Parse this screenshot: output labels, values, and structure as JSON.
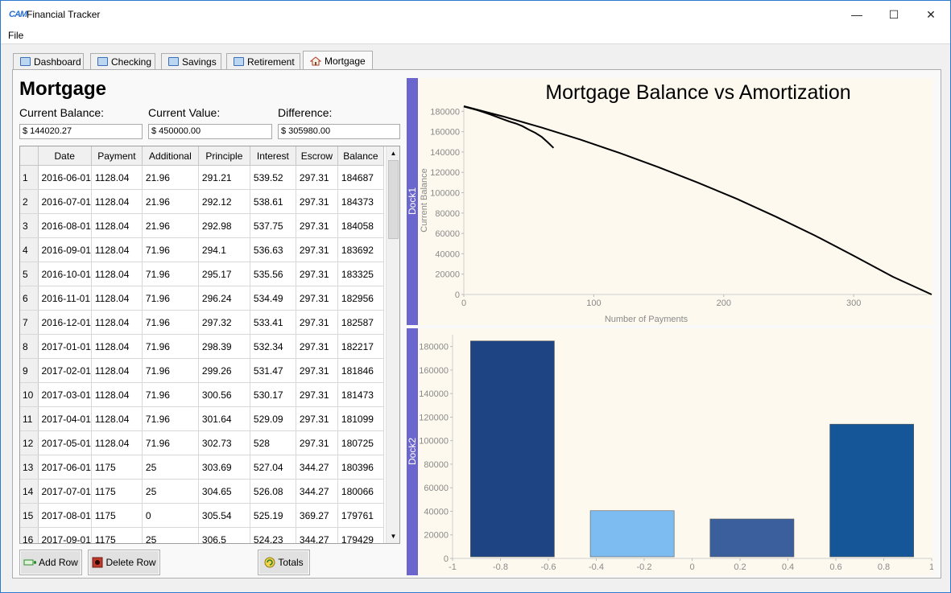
{
  "window": {
    "app_icon": "CAM",
    "title": "Financial Tracker",
    "controls": {
      "minimize": "—",
      "maximize": "☐",
      "close": "✕"
    }
  },
  "menu": {
    "file": "File"
  },
  "tabs": [
    {
      "label": "Dashboard",
      "icon": "money-icon"
    },
    {
      "label": "Checking",
      "icon": "money-icon"
    },
    {
      "label": "Savings",
      "icon": "money-icon"
    },
    {
      "label": "Retirement",
      "icon": "money-icon"
    },
    {
      "label": "Mortgage",
      "icon": "house-icon",
      "active": true
    }
  ],
  "mortgage": {
    "title": "Mortgage",
    "current_balance_label": "Current Balance:",
    "current_balance_value": "$ 144020.27",
    "current_value_label": "Current Value:",
    "current_value_value": "$ 450000.00",
    "difference_label": "Difference:",
    "difference_value": "$ 305980.00"
  },
  "table": {
    "columns": [
      "Date",
      "Payment",
      "Additional",
      "Principle",
      "Interest",
      "Escrow",
      "Balance"
    ],
    "rows": [
      [
        "2016-06-01",
        "1128.04",
        "21.96",
        "291.21",
        "539.52",
        "297.31",
        "184687"
      ],
      [
        "2016-07-01",
        "1128.04",
        "21.96",
        "292.12",
        "538.61",
        "297.31",
        "184373"
      ],
      [
        "2016-08-01",
        "1128.04",
        "21.96",
        "292.98",
        "537.75",
        "297.31",
        "184058"
      ],
      [
        "2016-09-01",
        "1128.04",
        "71.96",
        "294.1",
        "536.63",
        "297.31",
        "183692"
      ],
      [
        "2016-10-01",
        "1128.04",
        "71.96",
        "295.17",
        "535.56",
        "297.31",
        "183325"
      ],
      [
        "2016-11-01",
        "1128.04",
        "71.96",
        "296.24",
        "534.49",
        "297.31",
        "182956"
      ],
      [
        "2016-12-01",
        "1128.04",
        "71.96",
        "297.32",
        "533.41",
        "297.31",
        "182587"
      ],
      [
        "2017-01-01",
        "1128.04",
        "71.96",
        "298.39",
        "532.34",
        "297.31",
        "182217"
      ],
      [
        "2017-02-01",
        "1128.04",
        "71.96",
        "299.26",
        "531.47",
        "297.31",
        "181846"
      ],
      [
        "2017-03-01",
        "1128.04",
        "71.96",
        "300.56",
        "530.17",
        "297.31",
        "181473"
      ],
      [
        "2017-04-01",
        "1128.04",
        "71.96",
        "301.64",
        "529.09",
        "297.31",
        "181099"
      ],
      [
        "2017-05-01",
        "1128.04",
        "71.96",
        "302.73",
        "528",
        "297.31",
        "180725"
      ],
      [
        "2017-06-01",
        "1175",
        "25",
        "303.69",
        "527.04",
        "344.27",
        "180396"
      ],
      [
        "2017-07-01",
        "1175",
        "25",
        "304.65",
        "526.08",
        "344.27",
        "180066"
      ],
      [
        "2017-08-01",
        "1175",
        "0",
        "305.54",
        "525.19",
        "369.27",
        "179761"
      ],
      [
        "2017-09-01",
        "1175",
        "25",
        "306.5",
        "524.23",
        "344.27",
        "179429"
      ]
    ]
  },
  "buttons": {
    "add_row": "Add Row",
    "delete_row": "Delete Row",
    "totals": "Totals"
  },
  "docks": {
    "dock1": "Dock1",
    "dock2": "Dock2"
  },
  "chart_data": [
    {
      "type": "line",
      "title": "Mortgage Balance vs Amortization",
      "xlabel": "Number of Payments",
      "ylabel": "Current Balance",
      "xlim": [
        0,
        360
      ],
      "ylim": [
        0,
        185000
      ],
      "xticks": [
        0,
        100,
        200,
        300
      ],
      "yticks": [
        0,
        20000,
        40000,
        60000,
        80000,
        100000,
        120000,
        140000,
        160000,
        180000
      ],
      "grid": false,
      "series": [
        {
          "x": [
            0,
            30,
            60,
            90,
            120,
            150,
            180,
            210,
            240,
            270,
            300,
            330,
            360
          ],
          "y": [
            185000,
            175000,
            164000,
            152000,
            139000,
            125000,
            110000,
            94000,
            76500,
            58000,
            38000,
            17500,
            0
          ],
          "color": "#000000"
        },
        {
          "x": [
            0,
            5,
            10,
            15,
            20,
            25,
            30,
            35,
            40,
            45,
            50,
            55,
            60,
            65,
            69
          ],
          "y": [
            184700,
            183000,
            181300,
            179200,
            177000,
            174700,
            172300,
            170000,
            168000,
            165500,
            162000,
            158800,
            154800,
            149000,
            144020
          ],
          "color": "#000000"
        }
      ]
    },
    {
      "type": "bar",
      "title": "",
      "xlim": [
        -1,
        1
      ],
      "ylim": [
        0,
        190000
      ],
      "xticks": [
        -1,
        -0.8,
        -0.6,
        -0.4,
        -0.2,
        0,
        0.2,
        0.4,
        0.6,
        0.8,
        1
      ],
      "yticks": [
        0,
        20000,
        40000,
        60000,
        80000,
        100000,
        120000,
        140000,
        160000,
        180000
      ],
      "grid": false,
      "bars": [
        {
          "center": -0.75,
          "width": 0.35,
          "value": 184700,
          "color": "#1e4483"
        },
        {
          "center": -0.25,
          "width": 0.35,
          "value": 40500,
          "color": "#7cbcf0"
        },
        {
          "center": 0.25,
          "width": 0.35,
          "value": 33500,
          "color": "#3b5f9d"
        },
        {
          "center": 0.75,
          "width": 0.35,
          "value": 114000,
          "color": "#145697"
        }
      ]
    }
  ]
}
